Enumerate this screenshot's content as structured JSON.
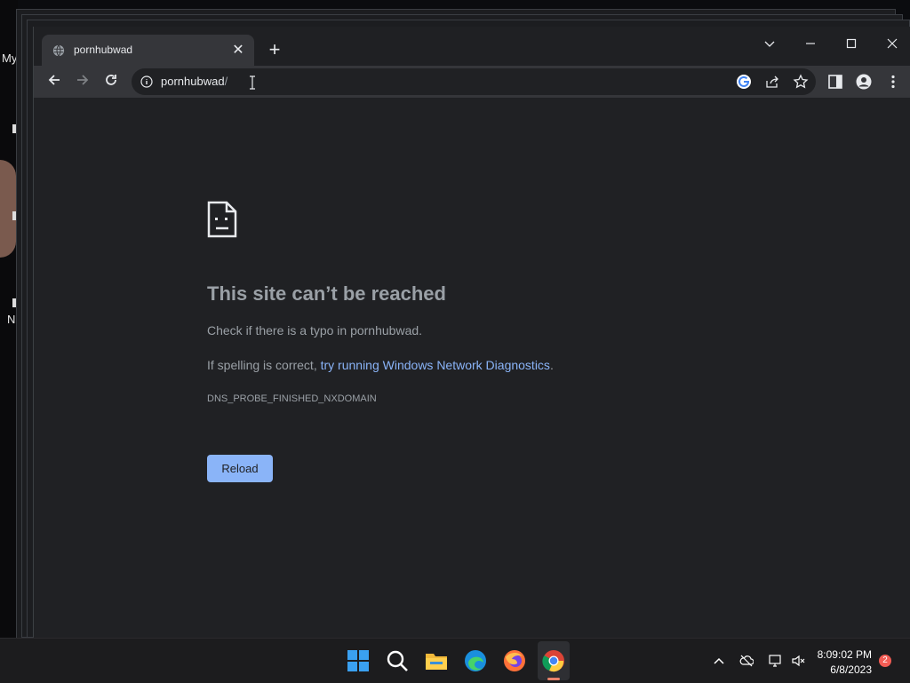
{
  "desktop": {
    "icon_label_1": "My",
    "icon_label_2": "N"
  },
  "tab": {
    "title": "pornhubwad",
    "favicon": "globe-icon",
    "close_glyph": "✕"
  },
  "new_tab_glyph": "+",
  "window_controls": {
    "tab_search": "chevron-down-icon",
    "minimize": "minimize-icon",
    "maximize": "maximize-icon",
    "close": "close-icon"
  },
  "omnibox": {
    "host": "pornhubwad",
    "path": "/"
  },
  "error_page": {
    "title": "This site can’t be reached",
    "typo_text": "Check if there is a typo in pornhubwad.",
    "spelling_prefix": "If spelling is correct, ",
    "diagnostics_link": "try running Windows Network Diagnostics",
    "spelling_suffix": ".",
    "error_code": "DNS_PROBE_FINISHED_NXDOMAIN",
    "reload_label": "Reload"
  },
  "taskbar": {
    "time": "8:09:02 PM",
    "date": "6/8/2023",
    "notification_count": "2"
  },
  "colors": {
    "accent": "#8ab4f8",
    "page_bg": "#202124",
    "toolbar_bg": "#35363a"
  }
}
